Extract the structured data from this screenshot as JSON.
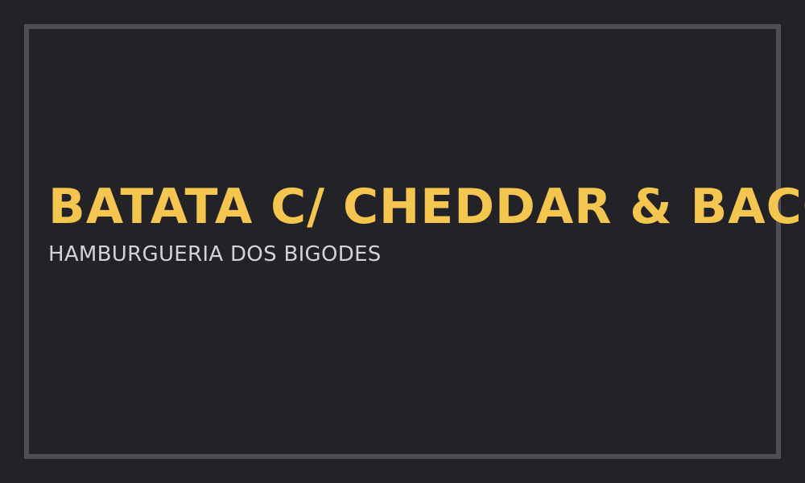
{
  "card": {
    "title": "BATATA C/ CHEDDAR & BACON",
    "subtitle": "HAMBURGUERIA DOS BIGODES"
  },
  "colors": {
    "background": "#232226",
    "frame_border": "#4f4e57",
    "title": "#f5c64f",
    "subtitle": "#d3d2d8"
  }
}
